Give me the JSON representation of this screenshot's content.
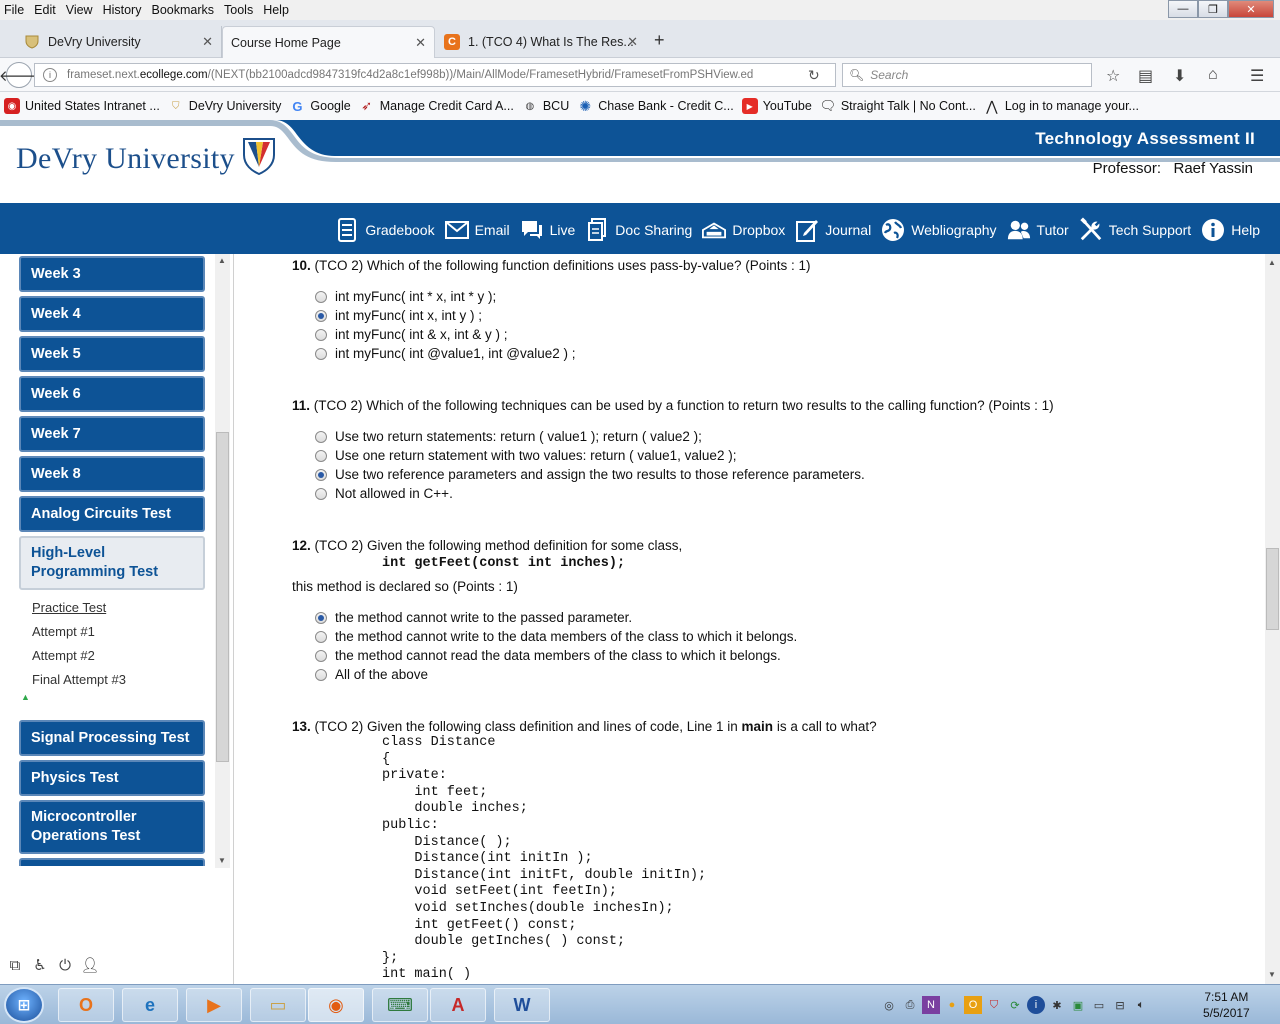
{
  "menu": [
    "File",
    "Edit",
    "View",
    "History",
    "Bookmarks",
    "Tools",
    "Help"
  ],
  "window_controls": {
    "minimize": "—",
    "maximize": "❐",
    "close": "✕"
  },
  "tabs": [
    {
      "label": "DeVry University",
      "icon": "devry-shield-icon"
    },
    {
      "label": "Course Home Page",
      "icon": ""
    },
    {
      "label": "1. (TCO 4) What Is The Res...",
      "icon": "chegg-icon"
    }
  ],
  "new_tab": "+",
  "nav": {
    "url_prefix": "frameset.next.",
    "url_domain": "ecollege.com",
    "url_suffix": "/(NEXT(bb2100adcd9847319fc4d2a8c1ef998b))/Main/AllMode/FramesetHybrid/FramesetFromPSHView.ed",
    "search_placeholder": "Search"
  },
  "bookmarks": [
    {
      "label": "United States Intranet ...",
      "color": "#d62020"
    },
    {
      "label": "DeVry University",
      "color": "#c9a24a"
    },
    {
      "label": "Google",
      "color": "#4285f4"
    },
    {
      "label": "Manage Credit Card A...",
      "color": "#b01818"
    },
    {
      "label": "BCU",
      "color": "#444444"
    },
    {
      "label": "Chase Bank - Credit C...",
      "color": "#1a5fb4"
    },
    {
      "label": "YouTube",
      "color": "#e52d27"
    },
    {
      "label": "Straight Talk | No Cont...",
      "color": "#222222"
    },
    {
      "label": "Log in to manage your...",
      "color": "#222222"
    }
  ],
  "header": {
    "university": "DeVry University",
    "course_title": "Technology Assessment II",
    "professor_label": "Professor:",
    "professor_name": "Raef Yassin",
    "brand_blue": "#0d5396"
  },
  "tools": [
    {
      "label": "Gradebook",
      "icon": "gradebook-icon"
    },
    {
      "label": "Email",
      "icon": "email-icon"
    },
    {
      "label": "Live",
      "icon": "chat-icon"
    },
    {
      "label": "Doc Sharing",
      "icon": "doc-sharing-icon"
    },
    {
      "label": "Dropbox",
      "icon": "dropbox-icon"
    },
    {
      "label": "Journal",
      "icon": "journal-icon"
    },
    {
      "label": "Webliography",
      "icon": "globe-icon"
    },
    {
      "label": "Tutor",
      "icon": "tutor-icon"
    },
    {
      "label": "Tech Support",
      "icon": "tools-icon"
    },
    {
      "label": "Help",
      "icon": "info-icon"
    }
  ],
  "sidebar": {
    "items": [
      {
        "label": "Week 3"
      },
      {
        "label": "Week 4"
      },
      {
        "label": "Week 5"
      },
      {
        "label": "Week 6"
      },
      {
        "label": "Week 7"
      },
      {
        "label": "Week 8"
      },
      {
        "label": "Analog Circuits Test"
      },
      {
        "label": "High-Level Programming Test",
        "line1": "High-Level",
        "line2": "Programming Test"
      },
      {
        "label": "Signal Processing Test"
      },
      {
        "label": "Physics Test"
      },
      {
        "label": "Microcontroller Operations Test",
        "line1": "Microcontroller",
        "line2": "Operations Test"
      }
    ],
    "subitems": [
      "Practice Test",
      "Attempt #1",
      "Attempt #2",
      "Final Attempt #3"
    ]
  },
  "questions": {
    "q10": {
      "num": "10.",
      "text": "(TCO 2) Which of the following function definitions uses pass-by-value? (Points : 1)",
      "options": [
        "int myFunc( int * x, int * y );",
        "int myFunc( int x, int y ) ;",
        "int myFunc( int & x, int & y ) ;",
        "int myFunc( int @value1, int @value2 ) ;"
      ],
      "selected": 1
    },
    "q11": {
      "num": "11.",
      "text": "(TCO 2) Which of the following techniques can be used by a function to return two results to the calling function? (Points : 1)",
      "options": [
        "Use two return statements: return ( value1 ); return ( value2 );",
        "Use one return statement with two values: return ( value1, value2 );",
        "Use two reference parameters and assign the two results to those reference parameters.",
        "Not allowed in C++."
      ],
      "selected": 2
    },
    "q12": {
      "num": "12.",
      "text": "(TCO 2) Given the following method definition for some class,",
      "code": "int getFeet(const int inches);",
      "text2": "this method is declared so (Points : 1)",
      "options": [
        "the method cannot write to the passed parameter.",
        "the method cannot write to the data members of the class to which it belongs.",
        "the method cannot read the data members of the class to which it belongs.",
        "All of the above"
      ],
      "selected": 0
    },
    "q13": {
      "num": "13.",
      "text_a": "(TCO 2) Given the following class definition and lines of code, Line 1 in",
      "text_bold": "main",
      "text_b": "is a call to what?",
      "code": "class Distance\n{\nprivate:\n    int feet;\n    double inches;\npublic:\n    Distance( );\n    Distance(int initIn );\n    Distance(int initFt, double initIn);\n    void setFeet(int feetIn);\n    void setInches(double inchesIn);\n    int getFeet() const;\n    double getInches( ) const;\n};\nint main( )"
    }
  },
  "taskbar": {
    "clock_time": "7:51 AM",
    "clock_date": "5/5/2017"
  }
}
